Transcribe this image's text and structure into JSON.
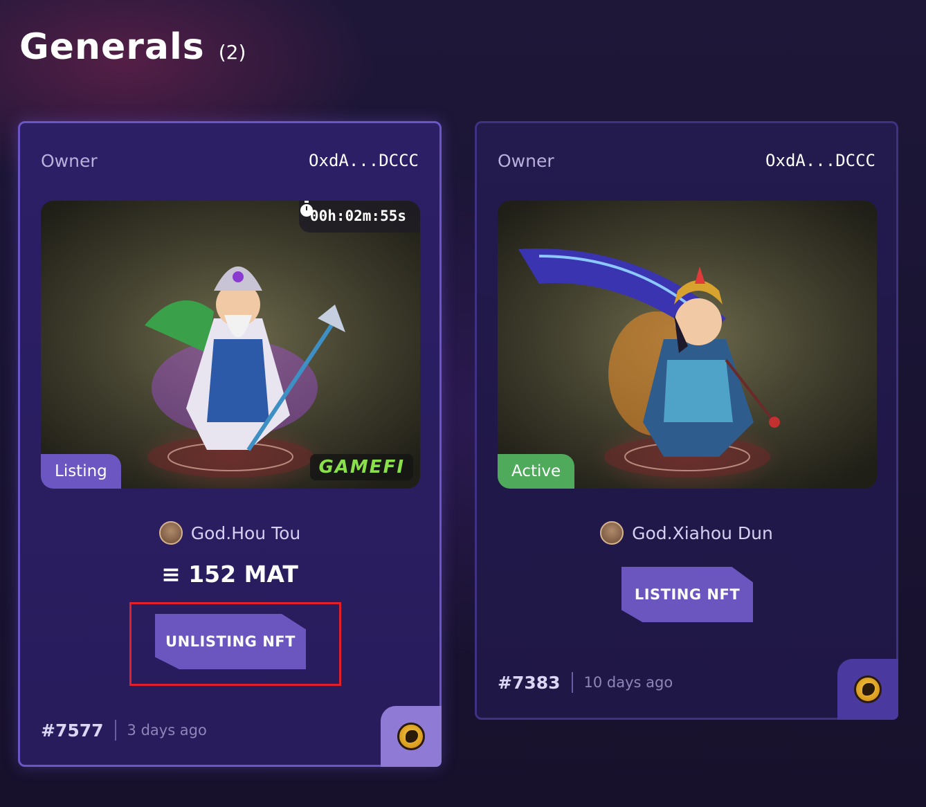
{
  "header": {
    "title": "Generals",
    "count": "(2)"
  },
  "cards": [
    {
      "owner_label": "Owner",
      "owner_address": "OxdA...DCCC",
      "timer": "00h:02m:55s",
      "status": "Listing",
      "watermark": "GAMEFI",
      "hero_name": "God.Hou Tou",
      "price": "≡ 152 MAT",
      "action_label": "UNLISTING NFT",
      "token_id": "#7577",
      "age": "3 days ago",
      "status_color": "#6b56c2"
    },
    {
      "owner_label": "Owner",
      "owner_address": "OxdA...DCCC",
      "status": "Active",
      "hero_name": "God.Xiahou Dun",
      "action_label": "LISTING NFT",
      "token_id": "#7383",
      "age": "10 days ago",
      "status_color": "#4faa5c"
    }
  ]
}
